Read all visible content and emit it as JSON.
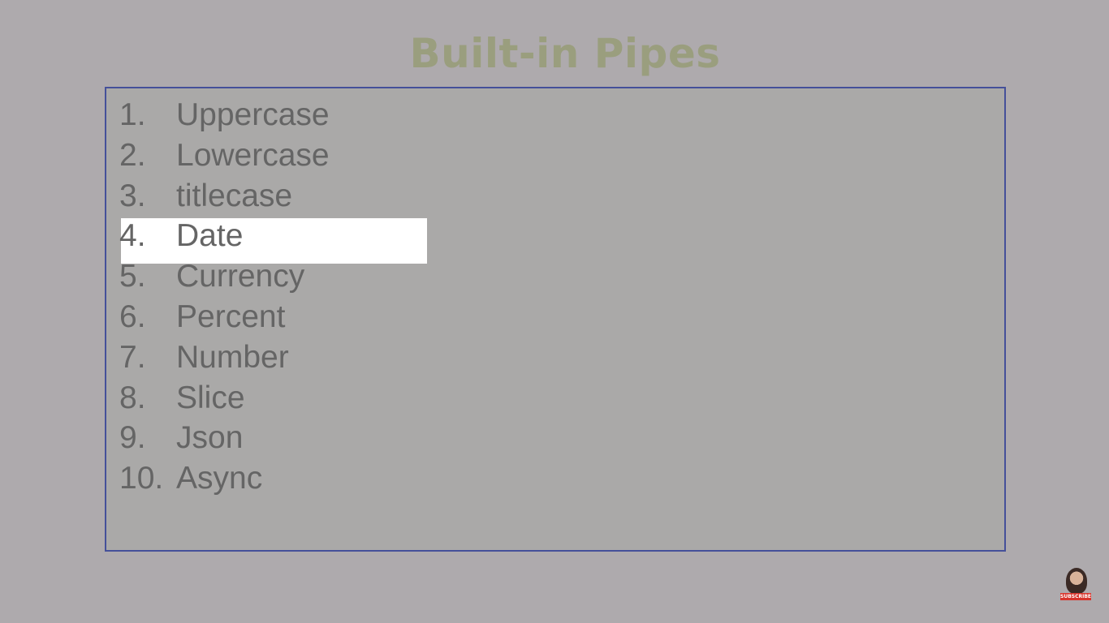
{
  "slide": {
    "title": "Built-in Pipes",
    "items": [
      {
        "num": "1.",
        "label": "Uppercase"
      },
      {
        "num": "2.",
        "label": "Lowercase"
      },
      {
        "num": "3.",
        "label": "titlecase"
      },
      {
        "num": "4.",
        "label": "Date"
      },
      {
        "num": "5.",
        "label": "Currency"
      },
      {
        "num": "6.",
        "label": "Percent"
      },
      {
        "num": "7.",
        "label": "Number"
      },
      {
        "num": "8.",
        "label": "Slice"
      },
      {
        "num": "9.",
        "label": "Json"
      },
      {
        "num": "10.",
        "label": "Async"
      }
    ],
    "highlighted_item": "Date"
  },
  "subscribe_badge": {
    "label": "SUBSCRIBE",
    "icon": "channel-avatar-icon"
  },
  "colors": {
    "background": "#aeaaad",
    "title": "#9a9e7e",
    "box_border": "#45509a",
    "item_text": "#656565",
    "highlight": "#ffffff",
    "badge": "#d8342c"
  }
}
